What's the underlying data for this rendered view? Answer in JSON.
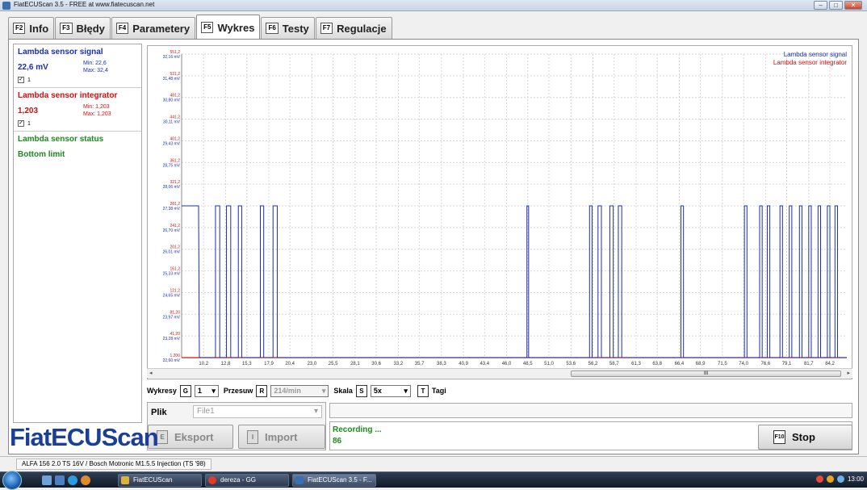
{
  "window": {
    "title": "FiatECUScan 3.5 - FREE at www.fiatecuscan.net",
    "controls": [
      "minimize-icon",
      "maximize-icon",
      "close-icon"
    ]
  },
  "tabs": [
    {
      "key": "F2",
      "label": "Info"
    },
    {
      "key": "F3",
      "label": "Błędy"
    },
    {
      "key": "F4",
      "label": "Parametery"
    },
    {
      "key": "F5",
      "label": "Wykres",
      "active": true
    },
    {
      "key": "F6",
      "label": "Testy"
    },
    {
      "key": "F7",
      "label": "Regulacje"
    }
  ],
  "sensors": {
    "signal": {
      "name": "Lambda sensor signal",
      "value": "22,6 mV",
      "min": "Min: 22,6",
      "max": "Max: 32,4",
      "check": "1",
      "color": "#1a2fae"
    },
    "integrator": {
      "name": "Lambda sensor integrator",
      "value": "1,203",
      "min": "Min: 1,203",
      "max": "Max: 1,203",
      "check": "1",
      "color": "#d01010"
    },
    "status": {
      "name": "Lambda sensor status",
      "value": "Bottom limit",
      "color": "#1c8a1c"
    }
  },
  "chart_data": {
    "type": "line",
    "legend": [
      "Lambda sensor signal",
      "Lambda sensor integrator"
    ],
    "legend_position": "top-right",
    "grid": true,
    "y_labels_red": [
      "551,2",
      "521,2",
      "481,2",
      "441,2",
      "401,2",
      "361,2",
      "321,2",
      "281,2",
      "241,2",
      "201,2",
      "161,2",
      "121,2",
      "81,20",
      "41,20",
      "1,200"
    ],
    "y_labels_blue": [
      "32,16 mV",
      "31,48 mV",
      "30,80 mV",
      "30,11 mV",
      "29,43 mV",
      "28,75 mV",
      "28,06 mV",
      "27,38 mV",
      "26,70 mV",
      "26,01 mV",
      "25,33 mV",
      "24,65 mV",
      "23,97 mV",
      "23,28 mV",
      "22,60 mV"
    ],
    "x_labels": [
      "10,2",
      "12,8",
      "15,3",
      "17,9",
      "20,4",
      "23,0",
      "25,5",
      "28,1",
      "30,6",
      "33,2",
      "35,7",
      "38,3",
      "40,9",
      "43,4",
      "46,0",
      "48,5",
      "51,0",
      "53,6",
      "56,2",
      "58,7",
      "61,3",
      "63,8",
      "66,4",
      "68,9",
      "71,5",
      "74,0",
      "76,6",
      "79,1",
      "81,7",
      "84,2"
    ],
    "y_range_mv": [
      22.6,
      32.16
    ],
    "series": [
      {
        "name": "Lambda sensor signal",
        "color": "#1a2fae",
        "low": 22.6,
        "high": 27.38,
        "pulses": [
          [
            7.8,
            9.6
          ],
          [
            11.6,
            12.1
          ],
          [
            12.9,
            13.4
          ],
          [
            14.3,
            14.7
          ],
          [
            16.9,
            17.3
          ],
          [
            18.4,
            18.9
          ],
          [
            48.4,
            48.6
          ],
          [
            55.8,
            56.1
          ],
          [
            56.8,
            57.2
          ],
          [
            58.2,
            58.6
          ],
          [
            59.2,
            59.6
          ],
          [
            66.6,
            66.9
          ],
          [
            74.1,
            74.4
          ],
          [
            75.9,
            76.2
          ],
          [
            76.8,
            77.1
          ],
          [
            78.3,
            78.6
          ],
          [
            79.4,
            79.7
          ],
          [
            80.6,
            80.9
          ],
          [
            81.7,
            82.0
          ],
          [
            82.8,
            83.1
          ],
          [
            83.9,
            84.2
          ],
          [
            84.8,
            85.1
          ]
        ]
      },
      {
        "name": "Lambda sensor integrator",
        "color": "#d01010",
        "constant": 1.203
      }
    ]
  },
  "controls": {
    "wykresy_label": "Wykresy",
    "wykresy_key": "G",
    "wykresy_value": "1",
    "przesuw_label": "Przesuw",
    "przesuw_key": "R",
    "przesuw_value": "214/min",
    "skala_label": "Skala",
    "skala_key": "S",
    "skala_value": "5x",
    "tagi_key": "T",
    "tagi_label": "Tagi"
  },
  "file": {
    "label": "Plik",
    "value": "File1",
    "export_key": "E",
    "export_label": "Eksport",
    "import_key": "I",
    "import_label": "Import"
  },
  "recording": {
    "label": "Recording ...",
    "count": "86",
    "stop_key": "F10",
    "stop_label": "Stop"
  },
  "logo": "FiatECUScan",
  "status": {
    "car": "ALFA 156 2.0 TS 16V / Bosch Motronic M1.5.5 Injection (TS '98)"
  },
  "taskbar": {
    "items": [
      "FiatECUScan",
      "dereza - GG",
      "FiatECUScan 3.5 - F..."
    ],
    "clock": "13:00"
  }
}
